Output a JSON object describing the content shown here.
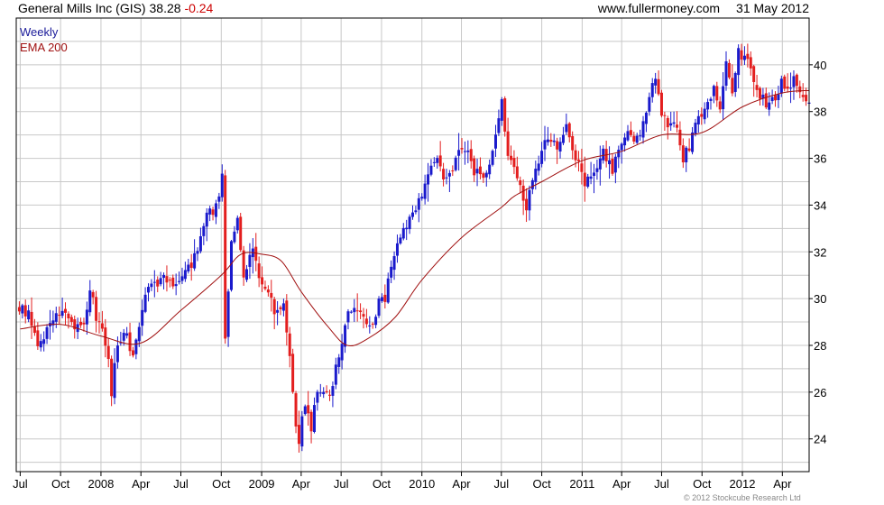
{
  "header": {
    "company": "General Mills Inc",
    "ticker": "(GIS)",
    "price": "38.28",
    "change": "-0.24",
    "site": "www.fullermoney.com",
    "date": "31 May 2012"
  },
  "legend": {
    "period": "Weekly",
    "ema": "EMA 200"
  },
  "copyright": "© 2012 Stockcube Research Ltd",
  "colors": {
    "up": "#1a1acc",
    "down": "#e31e1e",
    "ema": "#a01010",
    "grid": "#c8c8c8",
    "legend_period": "#1a1a99",
    "legend_ema": "#a01010"
  },
  "chart_data": {
    "type": "candlestick",
    "title": "General Mills Inc (GIS) 38.28 -0.24",
    "interval": "weekly",
    "x_range": [
      "2007-06-22",
      "2012-06-01"
    ],
    "ylim": [
      22.6,
      42.0
    ],
    "yticks": [
      24,
      26,
      28,
      30,
      32,
      34,
      36,
      38,
      40
    ],
    "x_tick_labels": [
      "Jul",
      "Oct",
      "2008",
      "Apr",
      "Jul",
      "Oct",
      "2009",
      "Apr",
      "Jul",
      "Oct",
      "2010",
      "Apr",
      "Jul",
      "Oct",
      "2011",
      "Apr",
      "Jul",
      "Oct",
      "2012",
      "Apr"
    ],
    "x_tick_dates": [
      "2007-07-01",
      "2007-10-01",
      "2008-01-01",
      "2008-04-01",
      "2008-07-01",
      "2008-10-01",
      "2009-01-01",
      "2009-04-01",
      "2009-07-01",
      "2009-10-01",
      "2010-01-01",
      "2010-04-01",
      "2010-07-01",
      "2010-10-01",
      "2011-01-01",
      "2011-04-01",
      "2011-07-01",
      "2011-10-01",
      "2012-01-01",
      "2012-04-01"
    ],
    "grid": true,
    "y_axis_side": "right",
    "legend_position": "top-left",
    "close_path": [
      [
        "2007-06-29",
        29.6
      ],
      [
        "2007-07-20",
        29.3
      ],
      [
        "2007-08-10",
        28.0
      ],
      [
        "2007-08-31",
        28.7
      ],
      [
        "2007-09-21",
        29.3
      ],
      [
        "2007-10-12",
        29.3
      ],
      [
        "2007-11-02",
        28.9
      ],
      [
        "2007-11-23",
        29.0
      ],
      [
        "2007-12-07",
        30.5
      ],
      [
        "2007-12-21",
        29.2
      ],
      [
        "2008-01-04",
        28.5
      ],
      [
        "2008-01-18",
        27.3
      ],
      [
        "2008-01-25",
        26.0
      ],
      [
        "2008-02-08",
        28.2
      ],
      [
        "2008-02-29",
        28.5
      ],
      [
        "2008-03-14",
        27.4
      ],
      [
        "2008-03-28",
        29.0
      ],
      [
        "2008-04-11",
        30.2
      ],
      [
        "2008-05-02",
        30.6
      ],
      [
        "2008-05-23",
        31.0
      ],
      [
        "2008-06-13",
        30.5
      ],
      [
        "2008-07-04",
        30.9
      ],
      [
        "2008-07-25",
        31.5
      ],
      [
        "2008-08-15",
        32.5
      ],
      [
        "2008-08-29",
        33.5
      ],
      [
        "2008-09-12",
        33.8
      ],
      [
        "2008-09-26",
        34.5
      ],
      [
        "2008-10-03",
        35.5
      ],
      [
        "2008-10-10",
        28.3
      ],
      [
        "2008-10-24",
        32.5
      ],
      [
        "2008-11-07",
        33.5
      ],
      [
        "2008-11-21",
        31.0
      ],
      [
        "2008-12-12",
        32.0
      ],
      [
        "2008-12-26",
        31.0
      ],
      [
        "2009-01-09",
        30.5
      ],
      [
        "2009-01-30",
        29.5
      ],
      [
        "2009-02-20",
        29.8
      ],
      [
        "2009-03-06",
        27.5
      ],
      [
        "2009-03-13",
        26.0
      ],
      [
        "2009-03-20",
        24.5
      ],
      [
        "2009-03-27",
        24.0
      ],
      [
        "2009-04-10",
        25.5
      ],
      [
        "2009-04-24",
        24.5
      ],
      [
        "2009-05-08",
        26.0
      ],
      [
        "2009-05-22",
        26.2
      ],
      [
        "2009-06-05",
        25.8
      ],
      [
        "2009-06-19",
        27.0
      ],
      [
        "2009-07-03",
        28.0
      ],
      [
        "2009-07-17",
        29.3
      ],
      [
        "2009-07-31",
        29.5
      ],
      [
        "2009-08-21",
        29.2
      ],
      [
        "2009-09-11",
        29.0
      ],
      [
        "2009-09-25",
        29.8
      ],
      [
        "2009-10-09",
        30.0
      ],
      [
        "2009-10-30",
        32.0
      ],
      [
        "2009-11-20",
        33.0
      ],
      [
        "2009-12-11",
        33.5
      ],
      [
        "2010-01-01",
        34.5
      ],
      [
        "2010-01-15",
        35.5
      ],
      [
        "2010-02-05",
        35.8
      ],
      [
        "2010-02-26",
        35.0
      ],
      [
        "2010-03-19",
        36.0
      ],
      [
        "2010-04-09",
        36.5
      ],
      [
        "2010-04-30",
        35.5
      ],
      [
        "2010-05-21",
        35.0
      ],
      [
        "2010-06-11",
        36.2
      ],
      [
        "2010-06-25",
        37.5
      ],
      [
        "2010-07-02",
        38.5
      ],
      [
        "2010-07-16",
        36.0
      ],
      [
        "2010-07-30",
        35.5
      ],
      [
        "2010-08-13",
        34.8
      ],
      [
        "2010-08-27",
        34.0
      ],
      [
        "2010-09-10",
        35.2
      ],
      [
        "2010-09-24",
        36.0
      ],
      [
        "2010-10-15",
        37.0
      ],
      [
        "2010-11-05",
        36.5
      ],
      [
        "2010-11-26",
        37.3
      ],
      [
        "2010-12-17",
        36.0
      ],
      [
        "2011-01-07",
        35.0
      ],
      [
        "2011-01-28",
        35.5
      ],
      [
        "2011-02-18",
        36.2
      ],
      [
        "2011-03-11",
        35.5
      ],
      [
        "2011-03-25",
        36.5
      ],
      [
        "2011-04-15",
        37.0
      ],
      [
        "2011-05-06",
        36.8
      ],
      [
        "2011-05-20",
        37.5
      ],
      [
        "2011-06-03",
        38.8
      ],
      [
        "2011-06-17",
        39.5
      ],
      [
        "2011-07-01",
        38.0
      ],
      [
        "2011-07-15",
        37.5
      ],
      [
        "2011-08-05",
        37.5
      ],
      [
        "2011-08-19",
        36.0
      ],
      [
        "2011-09-02",
        36.5
      ],
      [
        "2011-09-16",
        37.5
      ],
      [
        "2011-09-30",
        37.8
      ],
      [
        "2011-10-14",
        38.2
      ],
      [
        "2011-10-28",
        39.0
      ],
      [
        "2011-11-11",
        38.0
      ],
      [
        "2011-11-25",
        40.0
      ],
      [
        "2011-12-09",
        39.0
      ],
      [
        "2011-12-23",
        40.5
      ],
      [
        "2012-01-06",
        40.3
      ],
      [
        "2012-01-20",
        40.0
      ],
      [
        "2012-02-03",
        38.8
      ],
      [
        "2012-02-17",
        38.5
      ],
      [
        "2012-03-02",
        38.2
      ],
      [
        "2012-03-16",
        38.6
      ],
      [
        "2012-03-30",
        39.2
      ],
      [
        "2012-04-13",
        38.8
      ],
      [
        "2012-04-27",
        39.3
      ],
      [
        "2012-05-11",
        38.8
      ],
      [
        "2012-05-25",
        38.5
      ],
      [
        "2012-06-01",
        38.28
      ]
    ],
    "ema_200_path": [
      [
        "2007-07-01",
        28.7
      ],
      [
        "2007-10-01",
        28.9
      ],
      [
        "2008-01-01",
        28.4
      ],
      [
        "2008-04-01",
        28.1
      ],
      [
        "2008-07-01",
        29.5
      ],
      [
        "2008-10-01",
        31.0
      ],
      [
        "2008-11-15",
        31.9
      ],
      [
        "2009-01-01",
        31.9
      ],
      [
        "2009-02-15",
        31.6
      ],
      [
        "2009-04-01",
        30.3
      ],
      [
        "2009-06-01",
        28.8
      ],
      [
        "2009-07-15",
        28.0
      ],
      [
        "2009-09-01",
        28.3
      ],
      [
        "2009-11-01",
        29.2
      ],
      [
        "2010-01-01",
        30.8
      ],
      [
        "2010-04-01",
        32.6
      ],
      [
        "2010-07-01",
        33.9
      ],
      [
        "2010-08-01",
        34.4
      ],
      [
        "2010-10-01",
        35.0
      ],
      [
        "2011-01-01",
        35.9
      ],
      [
        "2011-04-01",
        36.3
      ],
      [
        "2011-07-01",
        37.0
      ],
      [
        "2011-10-01",
        37.1
      ],
      [
        "2012-01-01",
        38.2
      ],
      [
        "2012-04-01",
        38.8
      ],
      [
        "2012-06-01",
        38.9
      ]
    ]
  }
}
